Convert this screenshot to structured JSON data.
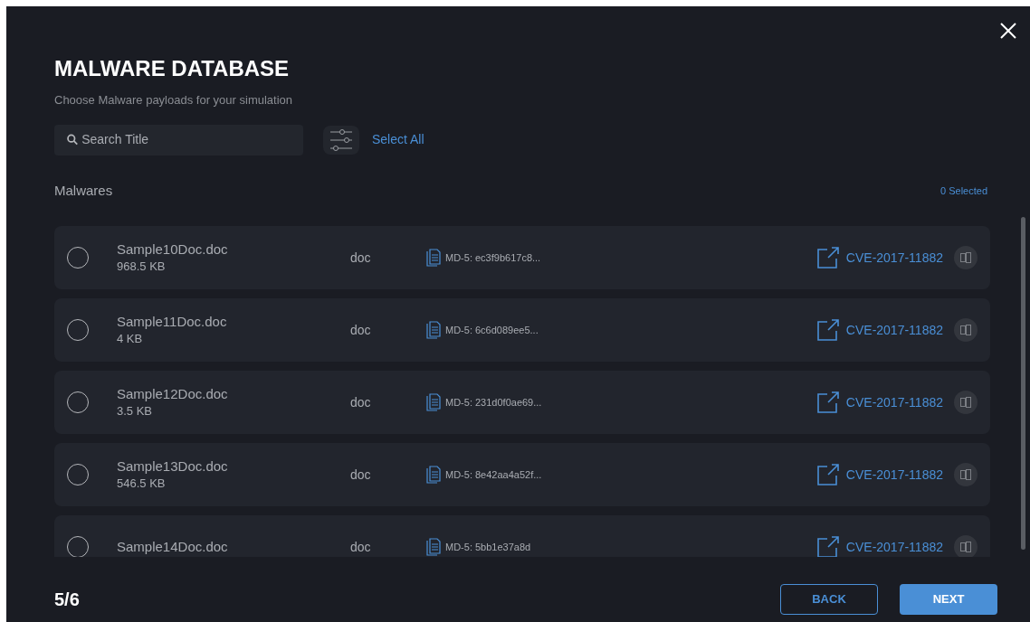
{
  "dialog": {
    "title": "MALWARE DATABASE",
    "subtitle": "Choose Malware payloads for your simulation"
  },
  "search": {
    "placeholder": "Search Title"
  },
  "select_all": "Select All",
  "list": {
    "heading": "Malwares",
    "selected_count": "0 Selected"
  },
  "rows": [
    {
      "name": "Sample10Doc.doc",
      "size": "968.5 KB",
      "type": "doc",
      "hash": "MD-5: ec3f9b617c8...",
      "cve": "CVE-2017-11882",
      "selected": false
    },
    {
      "name": "Sample11Doc.doc",
      "size": "4 KB",
      "type": "doc",
      "hash": "MD-5: 6c6d089ee5...",
      "cve": "CVE-2017-11882",
      "selected": false
    },
    {
      "name": "Sample12Doc.doc",
      "size": "3.5 KB",
      "type": "doc",
      "hash": "MD-5: 231d0f0ae69...",
      "cve": "CVE-2017-11882",
      "selected": false
    },
    {
      "name": "Sample13Doc.doc",
      "size": "546.5 KB",
      "type": "doc",
      "hash": "MD-5: 8e42aa4a52f...",
      "cve": "CVE-2017-11882",
      "selected": false
    },
    {
      "name": "Sample14Doc.doc",
      "type": "doc",
      "hash": "MD-5: 5bb1e37a8d",
      "cve": "CVE-2017-11882",
      "selected": false
    }
  ],
  "footer": {
    "step": "5/6",
    "back": "BACK",
    "next": "NEXT"
  }
}
